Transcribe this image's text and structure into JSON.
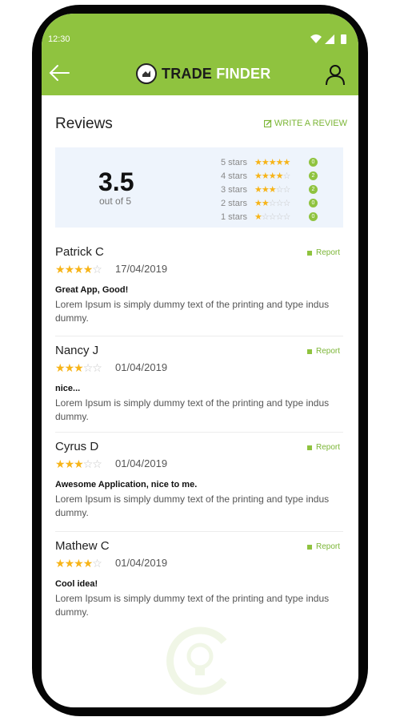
{
  "status_bar": {
    "time": "12:30"
  },
  "header": {
    "brand_part1": "TRADE",
    "brand_part2": "FINDER"
  },
  "page": {
    "title": "Reviews",
    "write_review": "WRITE A REVIEW"
  },
  "summary": {
    "average": "3.5",
    "out_of": "out of 5",
    "breakdown": [
      {
        "label": "5 stars",
        "stars": 5,
        "count": "0"
      },
      {
        "label": "4 stars",
        "stars": 4,
        "count": "2"
      },
      {
        "label": "3 stars",
        "stars": 3,
        "count": "2"
      },
      {
        "label": "2 stars",
        "stars": 2,
        "count": "0"
      },
      {
        "label": "1 stars",
        "stars": 1,
        "count": "0"
      }
    ]
  },
  "report_label": "Report",
  "reviews": [
    {
      "name": "Patrick C",
      "rating": 4,
      "date": "17/04/2019",
      "title": "Great App, Good!",
      "body": "Lorem Ipsum is simply dummy text of the printing and type indus dummy."
    },
    {
      "name": "Nancy J",
      "rating": 3,
      "date": "01/04/2019",
      "title": "nice...",
      "body": "Lorem Ipsum is simply dummy text of the printing and type indus dummy."
    },
    {
      "name": "Cyrus D",
      "rating": 3,
      "date": "01/04/2019",
      "title": "Awesome Application, nice to me.",
      "body": "Lorem Ipsum is simply dummy text of the printing and type indus dummy."
    },
    {
      "name": "Mathew C",
      "rating": 4,
      "date": "01/04/2019",
      "title": "Cool idea!",
      "body": "Lorem Ipsum is simply dummy text of the printing and type indus dummy."
    }
  ],
  "colors": {
    "brand_green": "#8fc33f",
    "star": "#f7b418",
    "summary_bg": "#eef4fc"
  },
  "icons": [
    "back-arrow-icon",
    "user-profile-icon",
    "edit-icon",
    "flag-icon",
    "logo-icon",
    "wifi-icon",
    "signal-icon",
    "battery-icon"
  ]
}
